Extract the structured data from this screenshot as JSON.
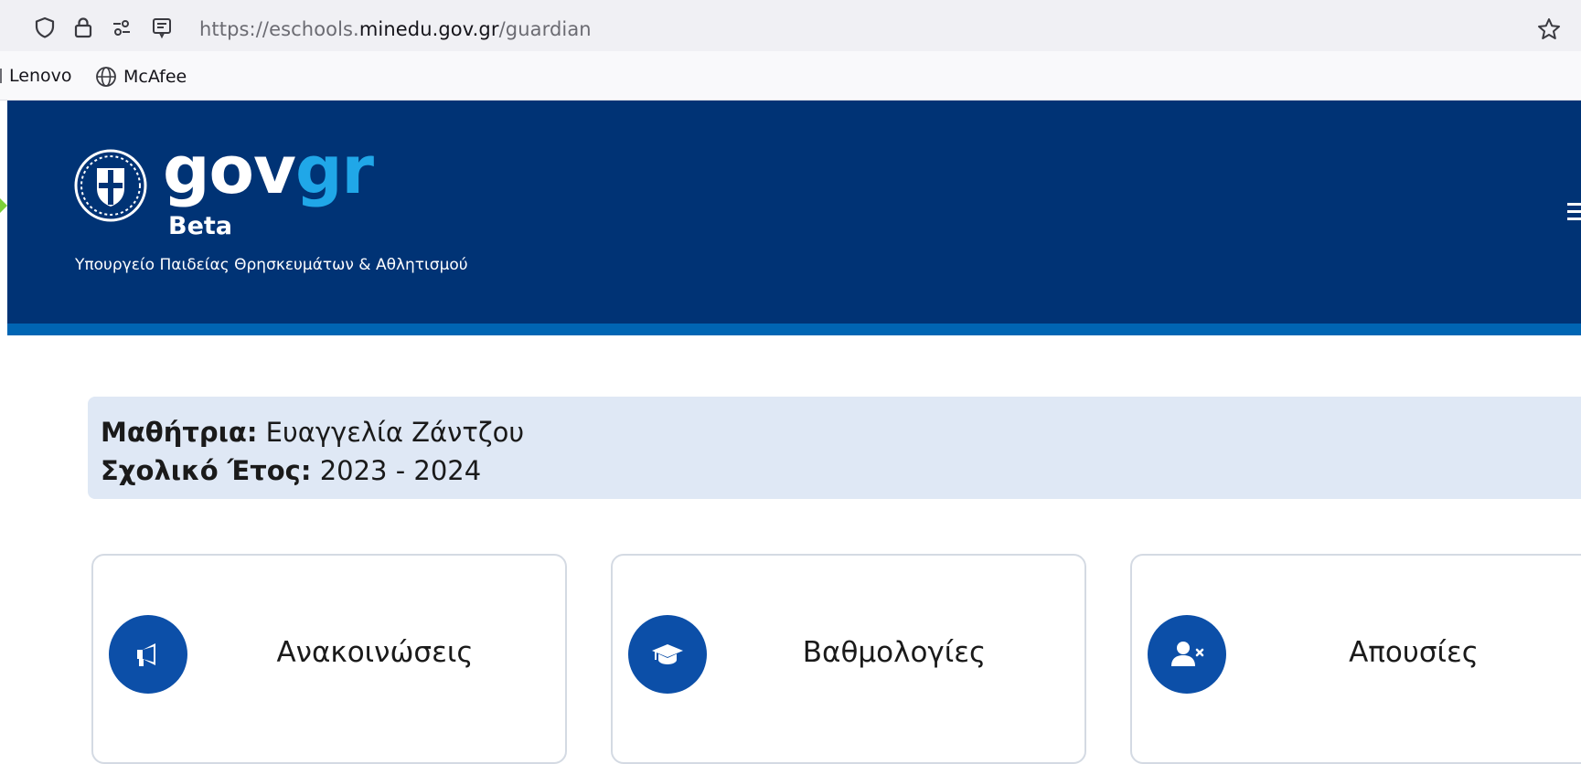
{
  "browser": {
    "url_prefix": "https://eschools.",
    "url_host": "minedu.gov.gr",
    "url_path": "/guardian",
    "bookmarks": [
      {
        "label": "Lenovo"
      },
      {
        "label": "McAfee"
      }
    ]
  },
  "header": {
    "wordmark_gov": "gov",
    "wordmark_gr": "gr",
    "beta": "Beta",
    "ministry": "Υπουργείο Παιδείας Θρησκευμάτων & Αθλητισμού"
  },
  "student": {
    "student_label": "Μαθήτρια:",
    "student_name": "Ευαγγελία Ζάντζου",
    "year_label": "Σχολικό Έτος:",
    "year_value": "2023 - 2024"
  },
  "cards": [
    {
      "label": "Ανακοινώσεις",
      "icon": "megaphone-icon"
    },
    {
      "label": "Βαθμολογίες",
      "icon": "graduation-cap-icon"
    },
    {
      "label": "Απουσίες",
      "icon": "user-times-icon"
    }
  ],
  "colors": {
    "header_bg": "#003375",
    "header_stripe": "#0065b3",
    "gr_accent": "#20a7e8",
    "info_panel_bg": "#dfe8f5",
    "icon_circle": "#0c4fa8"
  }
}
